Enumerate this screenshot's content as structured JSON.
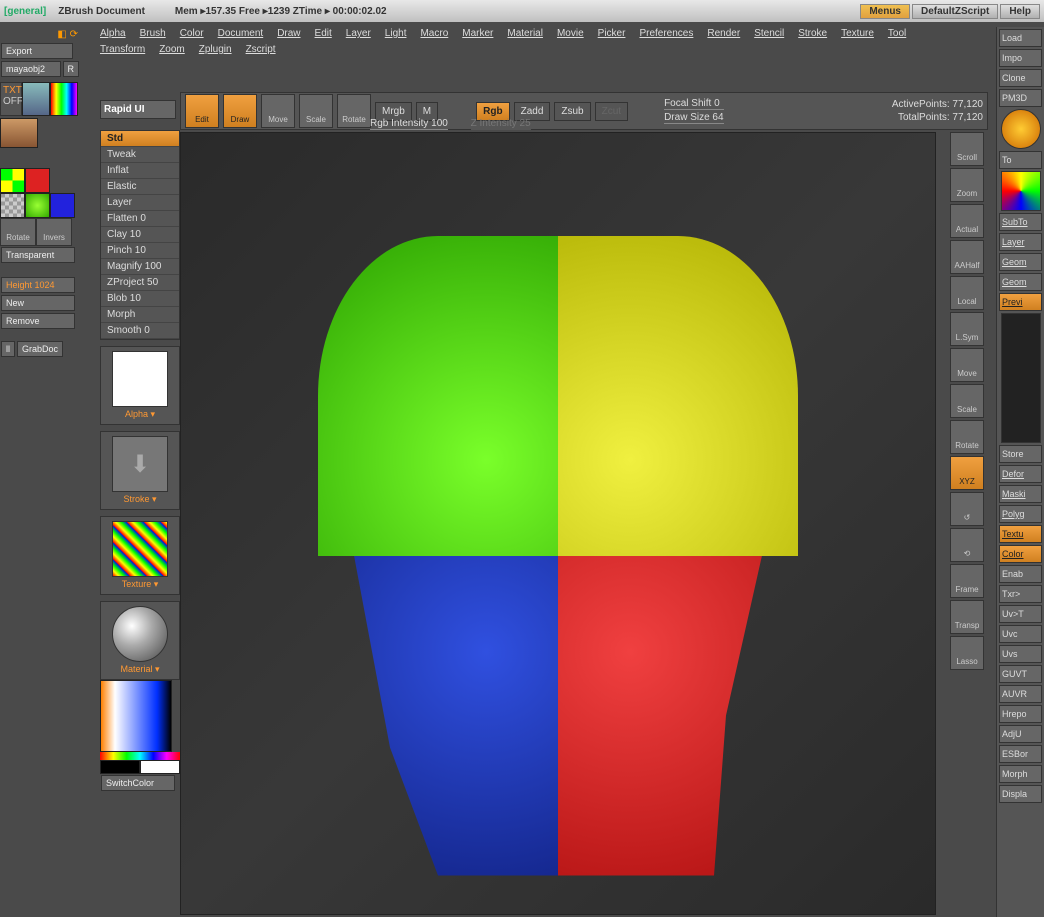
{
  "topbar": {
    "general": "[general]",
    "doc": "ZBrush Document",
    "mem": "Mem ▸157.35  Free ▸1239  ZTime ▸ 00:00:02.02",
    "menus": "Menus",
    "defz": "DefaultZScript",
    "help": "Help"
  },
  "menus": [
    "Alpha",
    "Brush",
    "Color",
    "Document",
    "Draw",
    "Edit",
    "Layer",
    "Light",
    "Macro",
    "Marker",
    "Material",
    "Movie",
    "Picker",
    "Preferences",
    "Render",
    "Stencil",
    "Stroke",
    "Texture",
    "Tool",
    "Transform",
    "Zoom",
    "Zplugin",
    "Zscript"
  ],
  "left": {
    "export": "Export",
    "mayaobj": "mayaobj2",
    "r": "R",
    "txtr": "TXTR",
    "off": "OFF",
    "rotate": "Rotate",
    "invers": "Invers",
    "transparent": "Transparent",
    "height": "Height 1024",
    "new": "New",
    "remove": "Remove",
    "ll": "ll",
    "grabdoc": "GrabDoc"
  },
  "brushes": {
    "header": "Rapid UI",
    "items": [
      "Std",
      "Tweak",
      "Inflat",
      "Elastic",
      "Layer",
      "Flatten 0",
      "Clay 10",
      "Pinch 10",
      "Magnify 100",
      "ZProject 50",
      "Blob 10",
      "Morph",
      "Smooth 0"
    ],
    "selected": 0
  },
  "thumbs": {
    "alpha": "Alpha ▾",
    "stroke": "Stroke ▾",
    "texture": "Texture ▾",
    "material": "Material ▾",
    "switch": "SwitchColor"
  },
  "shelf": {
    "edit": "Edit",
    "draw": "Draw",
    "move": "Move",
    "scale": "Scale",
    "rotate": "Rotate",
    "mrgb": "Mrgb",
    "m": "M",
    "rgb": "Rgb",
    "zadd": "Zadd",
    "zsub": "Zsub",
    "zcut": "Zcut",
    "rgbint": "Rgb Intensity 100",
    "zint": "Z Intensity 25",
    "focal": "Focal Shift 0",
    "drawsize": "Draw Size 64",
    "active": "ActivePoints: 77,120",
    "total": "TotalPoints: 77,120"
  },
  "rstrip": [
    "Scroll",
    "Zoom",
    "Actual",
    "AAHalf",
    "Local",
    "L.Sym",
    "Move",
    "Scale",
    "Rotate",
    "XYZ",
    "↺",
    "⟲",
    "Frame",
    "Transp",
    "Lasso"
  ],
  "far": {
    "top": [
      "Load",
      "Impo",
      "Clone",
      "PM3D"
    ],
    "mid": [
      "To",
      "SubTo",
      "Layer",
      "Geom",
      "Geom"
    ],
    "preview": "Previ",
    "store": "Store",
    "lower": [
      "Defor",
      "Maski",
      "Polyg"
    ],
    "textu": "Textu",
    "colorize": "Color",
    "enab": "Enab",
    "tx": [
      "Txr>",
      "Uv>T",
      "Uvc",
      "Uvs",
      "GUVT",
      "AUVR",
      "Hrepo",
      "AdjU",
      "ESBor",
      "Morph",
      "Displa"
    ]
  }
}
